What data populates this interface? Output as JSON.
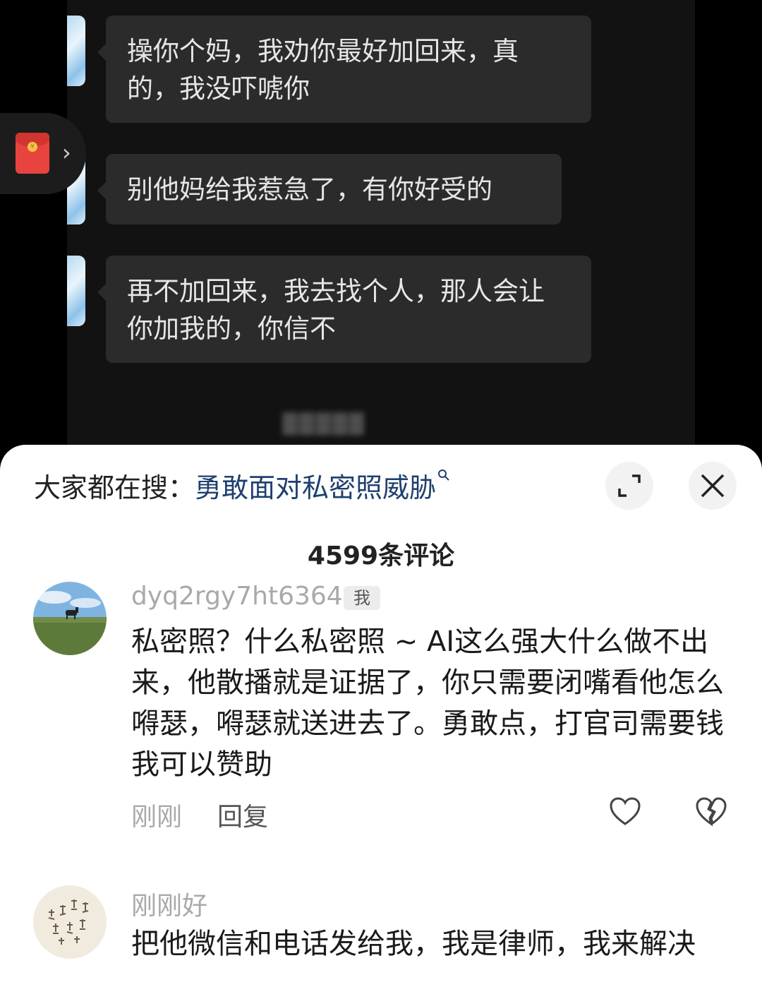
{
  "chat": {
    "messages": [
      {
        "text": "操你个妈，我劝你最好加回来，真的，我没吓唬你"
      },
      {
        "text": "别他妈给我惹急了，有你好受的"
      },
      {
        "text": "再不加回来，我去找个人，那人会让你加我的，你信不"
      }
    ],
    "red_packet_icon": "red-envelope-icon"
  },
  "sheet": {
    "search_prefix": "大家都在搜：",
    "search_term": "勇敢面对私密照威胁",
    "expand_icon": "expand-icon",
    "close_icon": "close-icon",
    "comment_count": "4599条评论"
  },
  "comments": [
    {
      "username": "dyq2rgy7ht6364",
      "badge": "我",
      "text": "私密照？什么私密照 ~ AI这么强大什么做不出来，他散播就是证据了，你只需要闭嘴看他怎么嘚瑟，嘚瑟就送进去了。勇敢点，打官司需要钱我可以赞助",
      "time": "刚刚",
      "reply_label": "回复",
      "like_icon": "heart-icon",
      "dislike_icon": "broken-heart-icon"
    },
    {
      "username": "刚刚好",
      "text": "把他微信和电话发给我，我是律师，我来解决"
    }
  ]
}
